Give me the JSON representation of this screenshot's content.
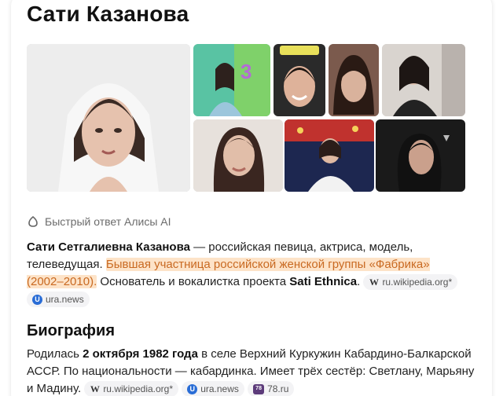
{
  "title": "Сати Казанова",
  "alice": {
    "label": "Быстрый ответ Алисы AI",
    "icon": "alice-icon"
  },
  "answer": {
    "name": "Сати Сетгалиевна Казанова",
    "intro": " — российская певица, актриса, модель, телеведущая. ",
    "highlight": "Бывшая участница российской женской группы «Фабрика» (2002–2010).",
    "rest_before": " Основатель и вокалистка проекта ",
    "project": "Sati Ethnica",
    "rest_after": ".",
    "sources": [
      {
        "label": "ru.wikipedia.org*",
        "icon": "wikipedia-icon"
      },
      {
        "label": "ura.news",
        "icon": "ura-news-icon"
      }
    ]
  },
  "biography": {
    "heading": "Биография",
    "text_1": "Родилась ",
    "date": "2 октября 1982 года",
    "text_2": " в селе Верхний Куркужин Кабардино-Балкарской АССР. По национальности — кабардинка. Имеет трёх сестёр: Светлану, Марьяну и Мадину.",
    "sources": [
      {
        "label": "ru.wikipedia.org*",
        "icon": "wikipedia-icon"
      },
      {
        "label": "ura.news",
        "icon": "ura-news-icon"
      },
      {
        "label": "78.ru",
        "icon": "78ru-icon"
      }
    ]
  },
  "colors": {
    "highlight_bg": "#fde3c8",
    "highlight_text": "#c96a22",
    "source_pill_bg": "#f3f3f5"
  }
}
